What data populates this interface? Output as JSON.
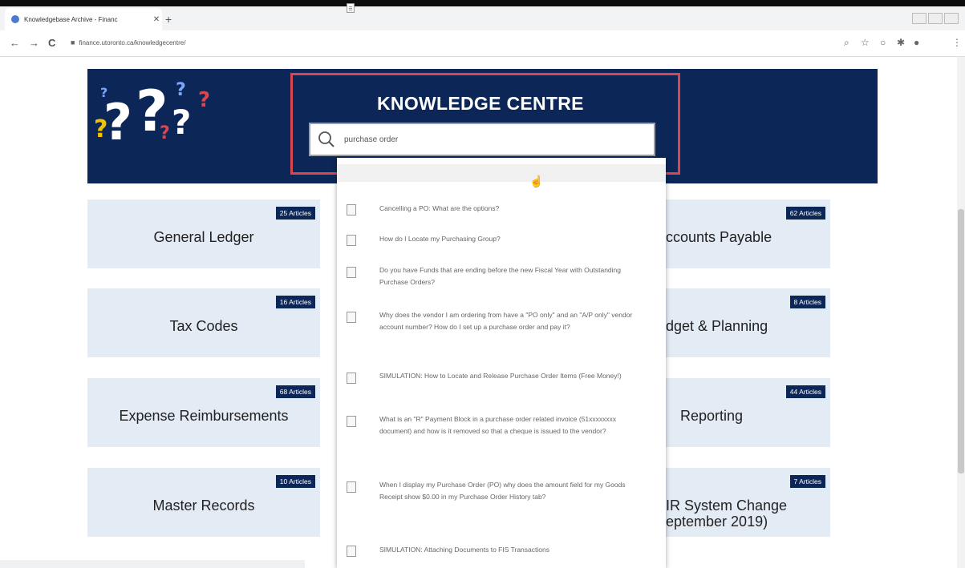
{
  "browser": {
    "tab_title": "Knowledgebase Archive - Financ",
    "tab_close": "✕",
    "new_tab": "+",
    "url": "finance.utoronto.ca/knowledgecentre/",
    "nav": {
      "back": "←",
      "forward": "→",
      "reload": "C"
    }
  },
  "header": {
    "title": "KNOWLEDGE CENTRE",
    "search_value": "purchase order"
  },
  "categories": [
    {
      "name": "General Ledger",
      "count": "25 Articles"
    },
    {
      "name": "Tax Codes",
      "count": "16 Articles"
    },
    {
      "name": "Expense Reimbursements",
      "count": "68 Articles"
    },
    {
      "name": "Master Records",
      "count": "10 Articles"
    },
    {
      "name": "ccounts Payable",
      "count": "62 Articles"
    },
    {
      "name": "dget & Planning",
      "count": "8 Articles"
    },
    {
      "name": "Reporting",
      "count": "44 Articles"
    },
    {
      "name": "IR System Change\neptember 2019)",
      "count": "7 Articles"
    }
  ],
  "suggestions": [
    "Cancelling a PO: What are the options?",
    "How do I Locate my Purchasing Group?",
    "Do you have Funds that are ending before the new Fiscal Year with Outstanding Purchase Orders?",
    "Why does the vendor I am ordering from have a \"PO only\" and an \"A/P only\" vendor account number? How do I set up a purchase order and pay it?",
    "SIMULATION: How to Locate and Release Purchase Order Items (Free Money!)",
    "What is an \"R\" Payment Block in a purchase order related invoice (51xxxxxxxx document) and how is it removed so that a cheque is issued to the vendor?",
    "When I display my Purchase Order (PO) why does the amount field for my Goods Receipt show $0.00 in my Purchase Order History tab?",
    "SIMULATION: Attaching Documents to FIS Transactions"
  ],
  "colors": {
    "banner": "#0c2757",
    "highlight": "#d9464d",
    "card": "#e3ebf4"
  }
}
